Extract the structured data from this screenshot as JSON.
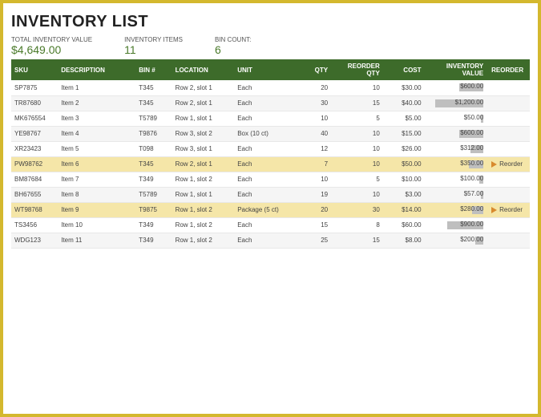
{
  "title": "INVENTORY LIST",
  "summary": {
    "total_label": "TOTAL INVENTORY VALUE",
    "total_value": "$4,649.00",
    "items_label": "INVENTORY ITEMS",
    "items_value": "11",
    "bins_label": "BIN COUNT:",
    "bins_value": "6"
  },
  "columns": {
    "sku": "SKU",
    "desc": "DESCRIPTION",
    "bin": "BIN #",
    "loc": "LOCATION",
    "unit": "UNIT",
    "qty": "QTY",
    "rqty": "REORDER QTY",
    "cost": "COST",
    "inv": "INVENTORY VALUE",
    "re": "REORDER"
  },
  "reorder_text": "Reorder",
  "max_inv": 1200,
  "rows": [
    {
      "sku": "SP7875",
      "desc": "Item 1",
      "bin": "T345",
      "loc": "Row 2, slot 1",
      "unit": "Each",
      "qty": "20",
      "rqty": "10",
      "cost": "$30.00",
      "inv": "$600.00",
      "inv_num": 600,
      "hl": false,
      "alt": false,
      "re": false
    },
    {
      "sku": "TR87680",
      "desc": "Item 2",
      "bin": "T345",
      "loc": "Row 2, slot 1",
      "unit": "Each",
      "qty": "30",
      "rqty": "15",
      "cost": "$40.00",
      "inv": "$1,200.00",
      "inv_num": 1200,
      "hl": false,
      "alt": true,
      "re": false
    },
    {
      "sku": "MK676554",
      "desc": "Item 3",
      "bin": "T5789",
      "loc": "Row 1, slot 1",
      "unit": "Each",
      "qty": "10",
      "rqty": "5",
      "cost": "$5.00",
      "inv": "$50.00",
      "inv_num": 50,
      "hl": false,
      "alt": false,
      "re": false
    },
    {
      "sku": "YE98767",
      "desc": "Item 4",
      "bin": "T9876",
      "loc": "Row 3, slot 2",
      "unit": "Box (10 ct)",
      "qty": "40",
      "rqty": "10",
      "cost": "$15.00",
      "inv": "$600.00",
      "inv_num": 600,
      "hl": false,
      "alt": true,
      "re": false
    },
    {
      "sku": "XR23423",
      "desc": "Item 5",
      "bin": "T098",
      "loc": "Row 3, slot 1",
      "unit": "Each",
      "qty": "12",
      "rqty": "10",
      "cost": "$26.00",
      "inv": "$312.00",
      "inv_num": 312,
      "hl": false,
      "alt": false,
      "re": false
    },
    {
      "sku": "PW98762",
      "desc": "Item 6",
      "bin": "T345",
      "loc": "Row 2, slot 1",
      "unit": "Each",
      "qty": "7",
      "rqty": "10",
      "cost": "$50.00",
      "inv": "$350.00",
      "inv_num": 350,
      "hl": true,
      "alt": false,
      "re": true
    },
    {
      "sku": "BM87684",
      "desc": "Item 7",
      "bin": "T349",
      "loc": "Row 1, slot 2",
      "unit": "Each",
      "qty": "10",
      "rqty": "5",
      "cost": "$10.00",
      "inv": "$100.00",
      "inv_num": 100,
      "hl": false,
      "alt": false,
      "re": false
    },
    {
      "sku": "BH67655",
      "desc": "Item 8",
      "bin": "T5789",
      "loc": "Row 1, slot 1",
      "unit": "Each",
      "qty": "19",
      "rqty": "10",
      "cost": "$3.00",
      "inv": "$57.00",
      "inv_num": 57,
      "hl": false,
      "alt": true,
      "re": false
    },
    {
      "sku": "WT98768",
      "desc": "Item 9",
      "bin": "T9875",
      "loc": "Row 1, slot 2",
      "unit": "Package (5 ct)",
      "qty": "20",
      "rqty": "30",
      "cost": "$14.00",
      "inv": "$280.00",
      "inv_num": 280,
      "hl": true,
      "alt": false,
      "re": true
    },
    {
      "sku": "TS3456",
      "desc": "Item 10",
      "bin": "T349",
      "loc": "Row 1, slot 2",
      "unit": "Each",
      "qty": "15",
      "rqty": "8",
      "cost": "$60.00",
      "inv": "$900.00",
      "inv_num": 900,
      "hl": false,
      "alt": false,
      "re": false
    },
    {
      "sku": "WDG123",
      "desc": "Item 11",
      "bin": "T349",
      "loc": "Row 1, slot 2",
      "unit": "Each",
      "qty": "25",
      "rqty": "15",
      "cost": "$8.00",
      "inv": "$200.00",
      "inv_num": 200,
      "hl": false,
      "alt": true,
      "re": false
    }
  ]
}
